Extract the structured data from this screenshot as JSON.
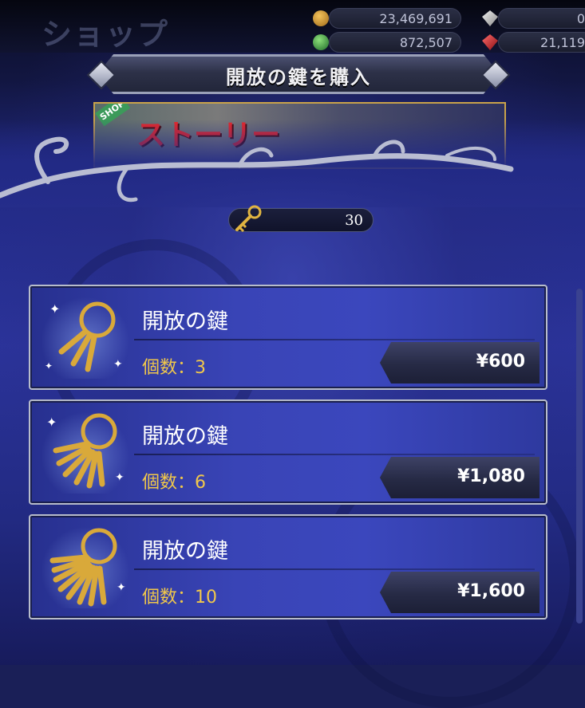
{
  "header": {
    "screen_title": "ショップ",
    "panel_title": "開放の鍵を購入"
  },
  "currencies": {
    "gil": "23,469,691",
    "gem": "0",
    "orb": "872,507",
    "ruby": "21,119"
  },
  "banner": {
    "tag": "SHOP",
    "text": "ストーリー"
  },
  "owned_keys": "30",
  "products": [
    {
      "name": "開放の鍵",
      "qty": "個数：3",
      "price": "¥600"
    },
    {
      "name": "開放の鍵",
      "qty": "個数：6",
      "price": "¥1,080"
    },
    {
      "name": "開放の鍵",
      "qty": "個数：10",
      "price": "¥1,600"
    }
  ],
  "colors": {
    "accent_gold": "#f1c84a",
    "panel_blue": "#3944b6"
  }
}
